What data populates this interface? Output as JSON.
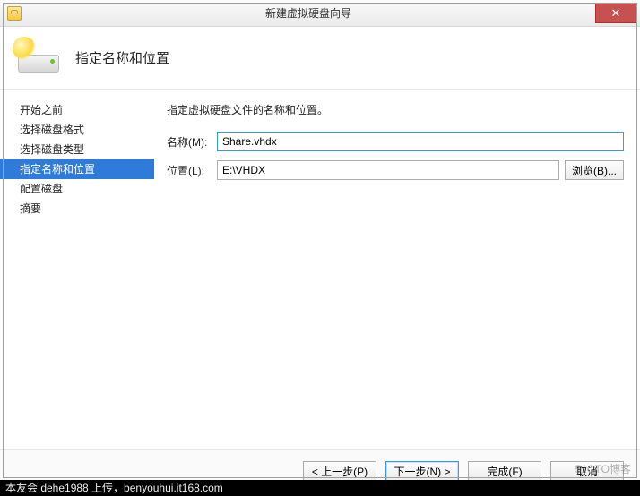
{
  "titlebar": {
    "title": "新建虚拟硬盘向导",
    "close_glyph": "✕"
  },
  "header": {
    "title": "指定名称和位置"
  },
  "sidebar": {
    "items": [
      {
        "label": "开始之前"
      },
      {
        "label": "选择磁盘格式"
      },
      {
        "label": "选择磁盘类型"
      },
      {
        "label": "指定名称和位置"
      },
      {
        "label": "配置磁盘"
      },
      {
        "label": "摘要"
      }
    ],
    "active_index": 3
  },
  "main": {
    "instruction": "指定虚拟硬盘文件的名称和位置。",
    "name_label": "名称(M):",
    "name_value": "Share.vhdx",
    "location_label": "位置(L):",
    "location_value": "E:\\VHDX",
    "browse_label": "浏览(B)..."
  },
  "footer": {
    "prev": "< 上一步(P)",
    "next": "下一步(N) >",
    "finish": "完成(F)",
    "cancel": "取消"
  },
  "strip": "本友会 dehe1988 上传，benyouhui.it168.com",
  "watermark": "51CTO博客"
}
